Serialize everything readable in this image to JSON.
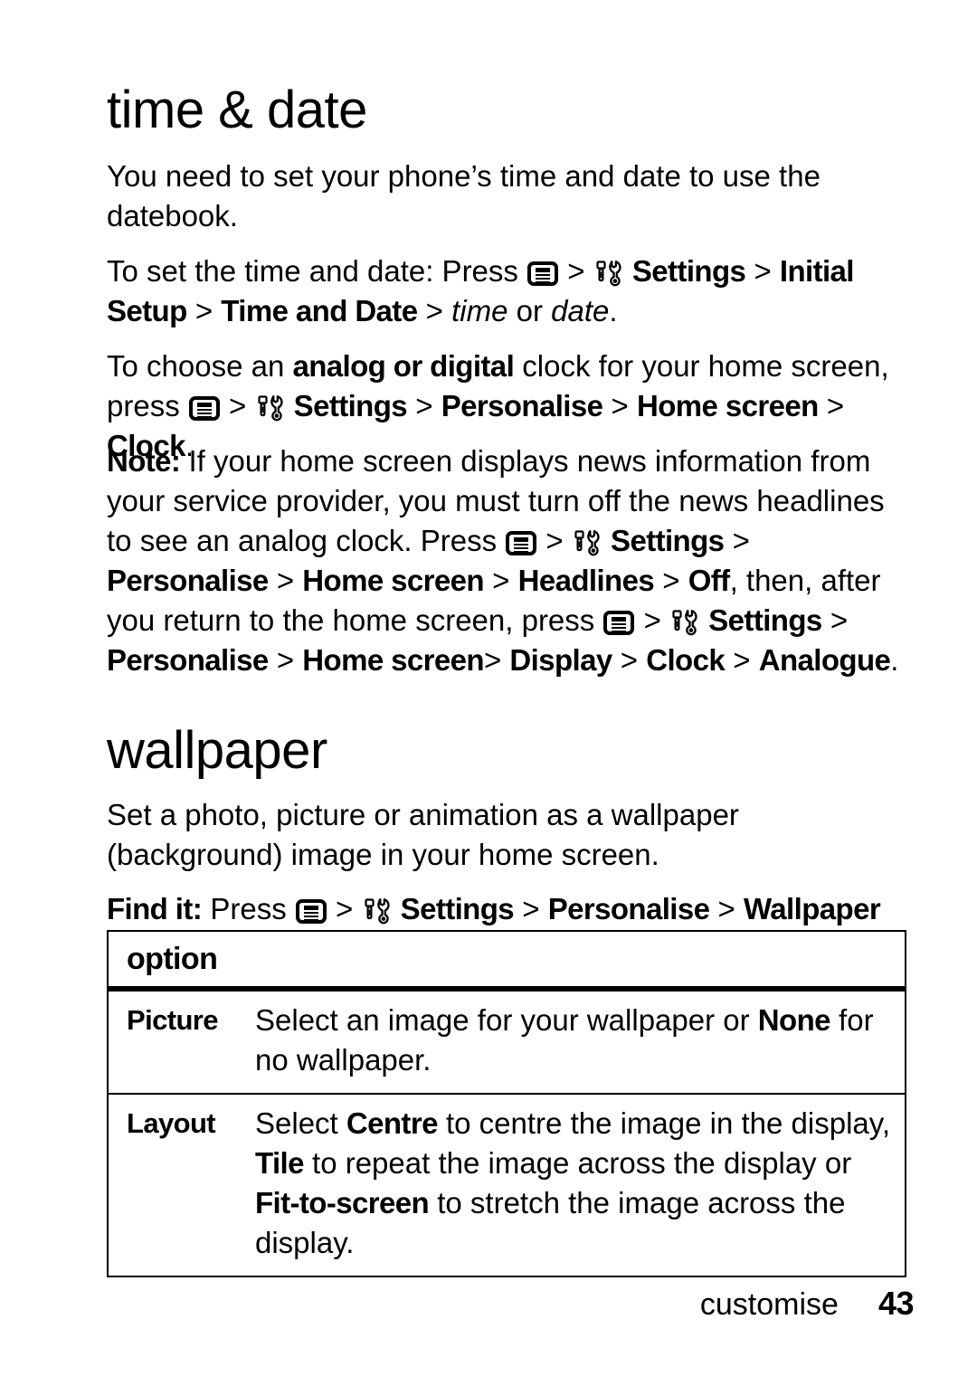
{
  "document": {
    "type": "user-guide-page",
    "page_number": "43",
    "footer_section": "customise"
  },
  "sections": [
    {
      "id": "time-date",
      "heading": "time & date",
      "paragraphs": [
        {
          "id": "intro",
          "text": "You need to set your phone’s time and date to use the datebook."
        },
        {
          "id": "set-time-date",
          "lead": "To set the time and date: Press ",
          "icons": [
            "menu-key-icon",
            "settings-tools-icon"
          ],
          "path": "Settings > Initial Setup > Time and Date > time or date.",
          "path_parts": [
            {
              "text": "Settings",
              "style": "bold"
            },
            {
              "text": ">",
              "style": "plain"
            },
            {
              "text": "Initial Setup",
              "style": "bold"
            },
            {
              "text": ">",
              "style": "plain"
            },
            {
              "text": "Time and Date",
              "style": "bold"
            },
            {
              "text": ">",
              "style": "plain"
            },
            {
              "text": "time",
              "style": "italic"
            },
            {
              "text": "or",
              "style": "plain"
            },
            {
              "text": "date",
              "style": "italic"
            }
          ]
        },
        {
          "id": "analog-digital",
          "lead": "To choose an ",
          "emphasis": "analog or digital",
          "mid": " clock for your home screen, press ",
          "path": "Settings > Personalise > Home screen > Clock."
        },
        {
          "id": "note",
          "label": "Note:",
          "body1": " If your home screen displays news information from your service provider, you must turn off the news headlines to see an analog clock. Press ",
          "path1": "Settings > Personalise > Home screen > Headlines > Off",
          "body2": ", then, after you return to the home screen, press ",
          "path2": "Settings > Personalise > Home screen> Display > Clock > Analogue."
        }
      ]
    },
    {
      "id": "wallpaper",
      "heading": "wallpaper",
      "paragraphs": [
        {
          "id": "wallpaper-intro",
          "text": "Set a photo, picture or animation as a wallpaper (background) image in your home screen."
        },
        {
          "id": "find-it",
          "label": "Find it:",
          "lead": " Press ",
          "path": "Settings > Personalise > Wallpaper"
        }
      ],
      "table": {
        "header": "option",
        "rows": [
          {
            "key": "Picture",
            "value_parts": [
              {
                "text": "Select an image for your wallpaper or ",
                "style": "plain"
              },
              {
                "text": "None",
                "style": "bold"
              },
              {
                "text": " for no wallpaper.",
                "style": "plain"
              }
            ]
          },
          {
            "key": "Layout",
            "value_parts": [
              {
                "text": "Select ",
                "style": "plain"
              },
              {
                "text": "Centre",
                "style": "bold"
              },
              {
                "text": " to centre the image in the display, ",
                "style": "plain"
              },
              {
                "text": "Tile",
                "style": "bold"
              },
              {
                "text": " to repeat the image across the display or ",
                "style": "plain"
              },
              {
                "text": "Fit-to-screen",
                "style": "bold"
              },
              {
                "text": " to stretch the image across the display.",
                "style": "plain"
              }
            ]
          }
        ]
      }
    }
  ],
  "labels": {
    "press": "Press ",
    "press_lower": "press ",
    "gt": ">",
    "settings": "Settings",
    "initial_setup": "Initial Setup",
    "time_and_date": "Time and Date",
    "time_italic": "time",
    "or": " or ",
    "date_italic": "date",
    "period": ".",
    "personalise": "Personalise",
    "home_screen": "Home screen",
    "home_screen_nospace": "Home screen",
    "clock": "Clock",
    "headlines": "Headlines",
    "off": "Off",
    "display": "Display",
    "analogue": "Analogue",
    "wallpaper_cap": "Wallpaper",
    "note_label": "Note:",
    "find_it_label": "Find it:",
    "to_set_lead": "To set the time and date: Press ",
    "to_choose_lead": "To choose an ",
    "analog_or_digital": "analog or digital",
    "clock_for_home": " clock for your home screen, ",
    "note_body_1": " If your home screen displays news information from your service provider, you must turn off the news headlines to see an analog clock. Press ",
    "note_body_2": ", then, after you return to the home screen, ",
    "intro_text": "You need to set your phone’s time and date to use the datebook.",
    "wallpaper_intro_text": "Set a photo, picture or animation as a wallpaper (background) image in your home screen."
  },
  "colors": {
    "ink": "#000000",
    "page": "#ffffff"
  }
}
